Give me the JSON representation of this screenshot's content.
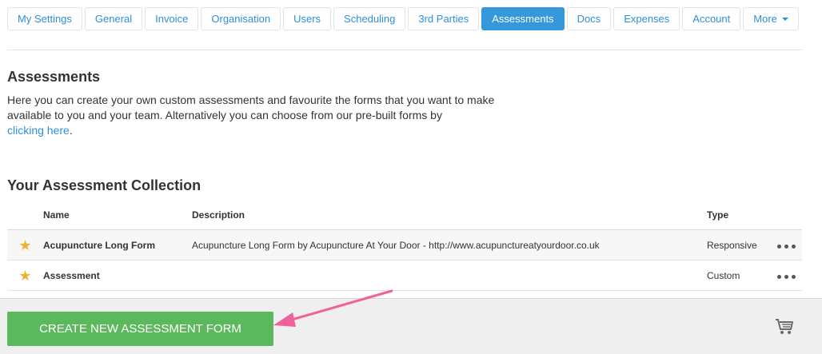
{
  "tabs": [
    {
      "label": "My Settings",
      "active": false
    },
    {
      "label": "General",
      "active": false
    },
    {
      "label": "Invoice",
      "active": false
    },
    {
      "label": "Organisation",
      "active": false
    },
    {
      "label": "Users",
      "active": false
    },
    {
      "label": "Scheduling",
      "active": false
    },
    {
      "label": "3rd Parties",
      "active": false
    },
    {
      "label": "Assessments",
      "active": true
    },
    {
      "label": "Docs",
      "active": false
    },
    {
      "label": "Expenses",
      "active": false
    },
    {
      "label": "Account",
      "active": false
    },
    {
      "label": "More",
      "active": false
    }
  ],
  "assessments": {
    "title": "Assessments",
    "intro_line1": "Here you can create your own custom assessments and favourite the forms that you want to make",
    "intro_line2": "available to you and your team. Alternatively you can choose from our pre-built forms by",
    "intro_link": "clicking here",
    "intro_end": "."
  },
  "collection": {
    "title": "Your Assessment Collection",
    "headers": {
      "name": "Name",
      "description": "Description",
      "type": "Type"
    },
    "rows": [
      {
        "favourite": true,
        "name": "Acupuncture Long Form",
        "description": "Acupuncture Long Form by Acupuncture At Your Door - http://www.acupunctureatyourdoor.co.uk",
        "type": "Responsive"
      },
      {
        "favourite": true,
        "name": "Assessment",
        "description": "",
        "type": "Custom"
      }
    ]
  },
  "footer": {
    "create_button": "CREATE NEW ASSESSMENT FORM",
    "cart_icon": "cart-icon"
  },
  "colors": {
    "accent": "#3498db",
    "link": "#2f8fd8",
    "create": "#5cb85c",
    "arrow": "#f0609a",
    "star": "#f0b22d"
  }
}
